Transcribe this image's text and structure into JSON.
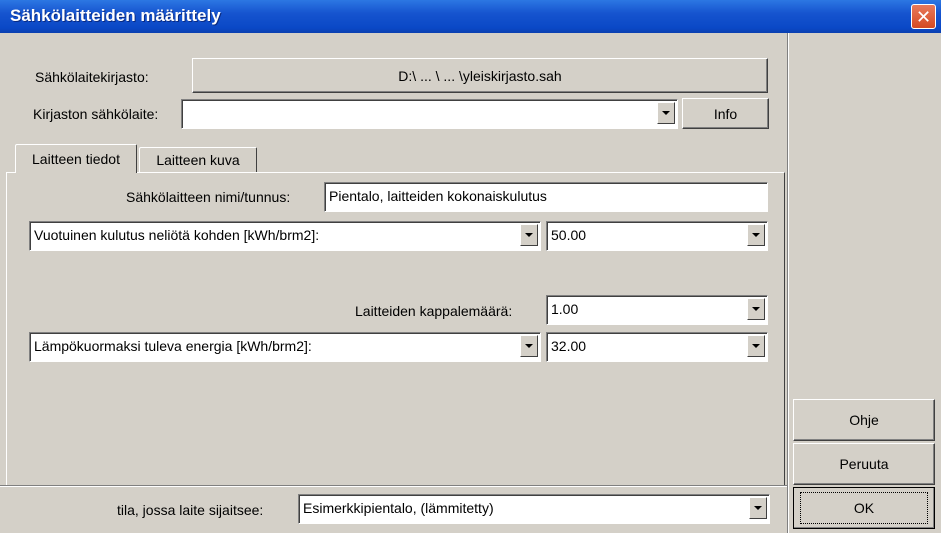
{
  "window": {
    "title": "Sähkölaitteiden määrittely"
  },
  "library": {
    "label": "Sähkölaitekirjasto:",
    "path_button": "D:\\ ... \\ ... \\yleiskirjasto.sah",
    "device_label": "Kirjaston sähkölaite:",
    "device_value": "",
    "info_button": "Info"
  },
  "tabs": [
    {
      "label": "Laitteen tiedot",
      "active": true
    },
    {
      "label": "Laitteen kuva",
      "active": false
    }
  ],
  "details": {
    "name_label": "Sähkölaitteen nimi/tunnus:",
    "name_value": "Pientalo, laitteiden kokonaiskulutus",
    "consumption_select": "Vuotuinen kulutus neliötä kohden [kWh/brm2]:",
    "consumption_value": "50.00",
    "count_label": "Laitteiden kappalemäärä:",
    "count_value": "1.00",
    "heatload_select": "Lämpökuormaksi tuleva energia [kWh/brm2]:",
    "heatload_value": "32.00"
  },
  "location": {
    "label": "tila, jossa laite sijaitsee:",
    "value": "Esimerkkipientalo, (lämmitetty)"
  },
  "buttons": {
    "help": "Ohje",
    "cancel": "Peruuta",
    "ok": "OK"
  },
  "icons": {
    "close": "close-icon",
    "dropdown": "chevron-down-icon"
  }
}
